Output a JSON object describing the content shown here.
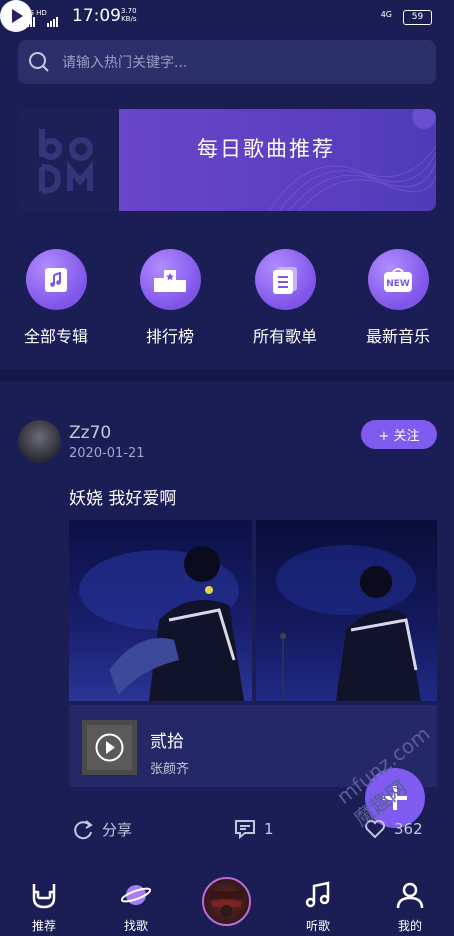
{
  "status_bar": {
    "signal1": "4G HD",
    "signal2": "4G",
    "time": "17:09",
    "speed_value": "3.70",
    "speed_unit": "KB/s",
    "network": "4G",
    "battery": "59"
  },
  "search": {
    "placeholder": "请输入热门关键字..."
  },
  "banner": {
    "title": "每日歌曲推荐"
  },
  "categories": [
    {
      "label": "全部专辑",
      "icon": "album-icon"
    },
    {
      "label": "排行榜",
      "icon": "chart-icon"
    },
    {
      "label": "所有歌单",
      "icon": "playlist-icon"
    },
    {
      "label": "最新音乐",
      "icon": "new-icon"
    }
  ],
  "post": {
    "username": "Zz70",
    "date": "2020-01-21",
    "follow_label": "+ 关注",
    "text": "妖娆 我好爱啊",
    "song": {
      "title": "贰拾",
      "artist": "张颜齐"
    },
    "actions": {
      "share": "分享",
      "comments": "1",
      "likes": "362"
    }
  },
  "nav": [
    {
      "label": "推荐",
      "icon": "rock-hand-icon"
    },
    {
      "label": "找歌",
      "icon": "planet-icon"
    },
    {
      "label": "听歌",
      "icon": "music-note-icon"
    },
    {
      "label": "我的",
      "icon": "user-icon"
    }
  ],
  "watermark": "mfunz.com 魔趣网",
  "colors": {
    "background": "#1b1e55",
    "accent": "#7e5cf0"
  }
}
